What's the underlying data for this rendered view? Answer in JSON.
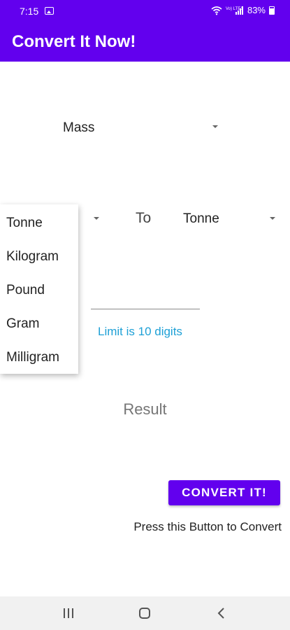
{
  "status_bar": {
    "time": "7:15",
    "network": "Vo) LTE1",
    "battery": "83%"
  },
  "app_bar": {
    "title": "Convert It Now!"
  },
  "category_spinner": {
    "value": "Mass"
  },
  "to_label": "To",
  "to_spinner": {
    "value": "Tonne"
  },
  "amount_input": {
    "value": "",
    "placeholder": ""
  },
  "limit_text": "Limit is 10 digits",
  "result_text": "Result",
  "convert_button": {
    "label": "CONVERT IT!"
  },
  "hint_text": "Press this Button to Convert",
  "dropdown": {
    "items": [
      "Tonne",
      "Kilogram",
      "Pound",
      "Gram",
      "Milligram"
    ]
  },
  "colors": {
    "primary": "#6200ee",
    "accent_text": "#1ea0d6"
  },
  "icons": {
    "nav": [
      "recents-icon",
      "home-icon",
      "back-icon"
    ]
  }
}
